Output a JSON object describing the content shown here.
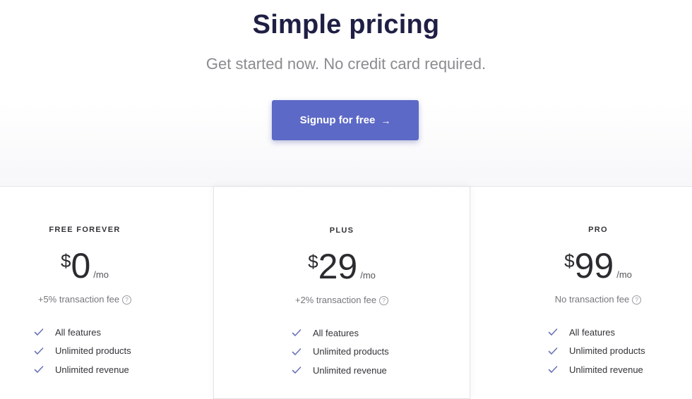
{
  "hero": {
    "title": "Simple pricing",
    "subtitle": "Get started now. No credit card required.",
    "cta_label": "Signup for free",
    "cta_arrow": "→"
  },
  "colors": {
    "accent": "#5c69c6",
    "title": "#1f1f45",
    "check": "#6b74b8"
  },
  "plans": [
    {
      "name": "FREE FOREVER",
      "currency": "$",
      "amount": "0",
      "period": "/mo",
      "fee": "+5% transaction fee",
      "features": [
        "All features",
        "Unlimited products",
        "Unlimited revenue"
      ]
    },
    {
      "name": "PLUS",
      "currency": "$",
      "amount": "29",
      "period": "/mo",
      "fee": "+2% transaction fee",
      "features": [
        "All features",
        "Unlimited products",
        "Unlimited revenue"
      ]
    },
    {
      "name": "PRO",
      "currency": "$",
      "amount": "99",
      "period": "/mo",
      "fee": "No transaction fee",
      "features": [
        "All features",
        "Unlimited products",
        "Unlimited revenue"
      ]
    }
  ],
  "icons": {
    "check": "check-icon",
    "help": "question-circle-icon",
    "help_glyph": "?"
  }
}
